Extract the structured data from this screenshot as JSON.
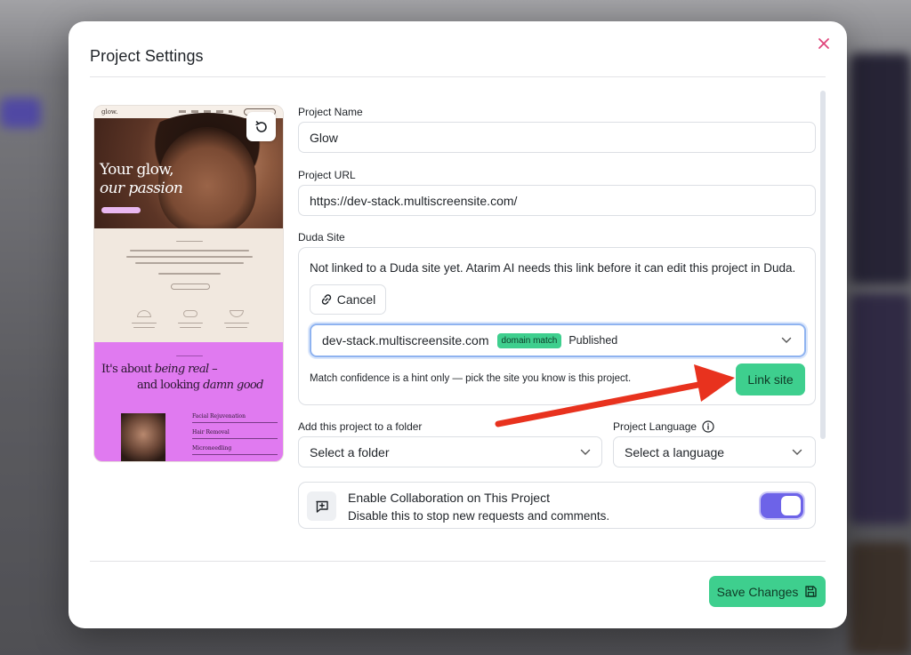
{
  "modal": {
    "title": "Project Settings"
  },
  "preview": {
    "logo": "glow.",
    "hero_line1": "Your glow,",
    "hero_line2": "our passion",
    "pink_line1": "It's about",
    "pink_line1_italic": "being real",
    "pink_line2": "and looking",
    "pink_line2_italic": "damn good",
    "treatments": [
      "Facial Rejuvenation",
      "Hair Removal",
      "Microneedling"
    ]
  },
  "form": {
    "project_name_label": "Project Name",
    "project_name_value": "Glow",
    "project_url_label": "Project URL",
    "project_url_value": "https://dev-stack.multiscreensite.com/",
    "duda_label": "Duda Site",
    "duda_message": "Not linked to a Duda site yet. Atarim AI needs this link before it can edit this project in Duda.",
    "cancel_label": "Cancel",
    "site_url": "dev-stack.multiscreensite.com",
    "site_badge": "domain match",
    "site_status": "Published",
    "hint": "Match confidence is a hint only — pick the site you know is this project.",
    "link_site_label": "Link site",
    "folder_label": "Add this project to a folder",
    "folder_value": "Select a folder",
    "language_label": "Project Language",
    "language_value": "Select a language",
    "collab_title": "Enable Collaboration on This Project",
    "collab_sub": "Disable this to stop new requests and comments.",
    "collab_enabled": true
  },
  "footer": {
    "save_label": "Save Changes"
  },
  "colors": {
    "accent_green": "#3ecf8e",
    "toggle_purple": "#6d63e8",
    "close_pink": "#e0457b",
    "arrow_red": "#e8321e"
  }
}
